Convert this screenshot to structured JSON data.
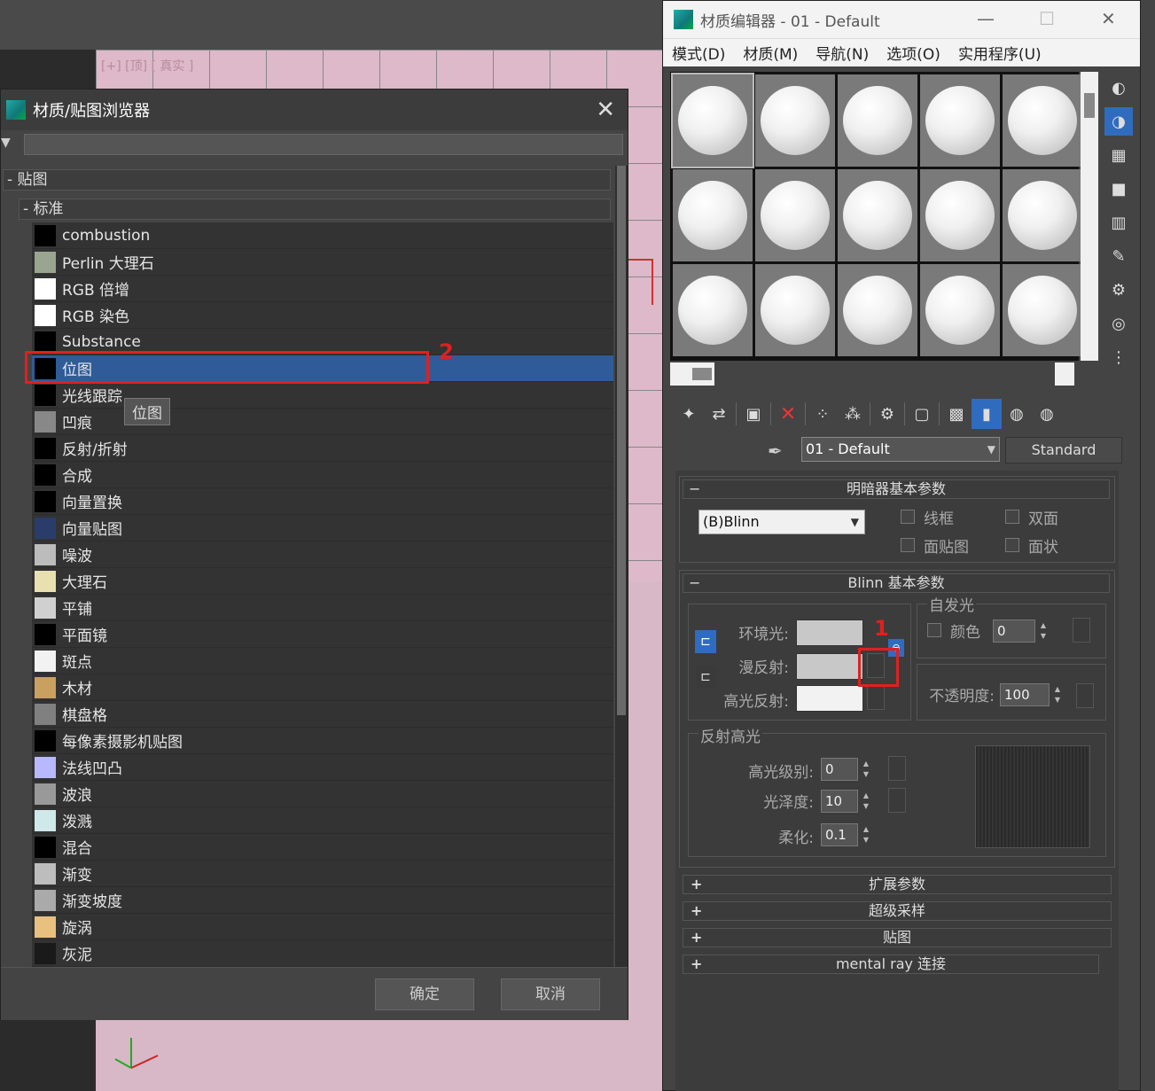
{
  "viewport": {
    "label": "[+] [顶] [ 真实 ]"
  },
  "browser": {
    "title": "材质/贴图浏览器",
    "close": "✕",
    "group_maps": "- 贴图",
    "group_standard": "- 标准",
    "items": [
      {
        "label": "combustion",
        "swatch": "#000000"
      },
      {
        "label": "Perlin 大理石",
        "swatch": "#9aa58f"
      },
      {
        "label": "RGB 倍增",
        "swatch": "#ffffff"
      },
      {
        "label": "RGB 染色",
        "swatch": "#ffffff"
      },
      {
        "label": "Substance",
        "swatch": "#000000"
      },
      {
        "label": "位图",
        "swatch": "#000000"
      },
      {
        "label": "光线跟踪",
        "swatch": "#000000"
      },
      {
        "label": "凹痕",
        "swatch": "#888888"
      },
      {
        "label": "反射/折射",
        "swatch": "#000000"
      },
      {
        "label": "合成",
        "swatch": "#000000"
      },
      {
        "label": "向量置换",
        "swatch": "#000000"
      },
      {
        "label": "向量贴图",
        "swatch": "#2a3d6a"
      },
      {
        "label": "噪波",
        "swatch": "#bcbcbc"
      },
      {
        "label": "大理石",
        "swatch": "#e8e0b0"
      },
      {
        "label": "平铺",
        "swatch": "#d0d0d0"
      },
      {
        "label": "平面镜",
        "swatch": "#000000"
      },
      {
        "label": "斑点",
        "swatch": "#f2f2f2"
      },
      {
        "label": "木材",
        "swatch": "#c8a060"
      },
      {
        "label": "棋盘格",
        "swatch": "#808080"
      },
      {
        "label": "每像素摄影机贴图",
        "swatch": "#000000"
      },
      {
        "label": "法线凹凸",
        "swatch": "#b8b8ff"
      },
      {
        "label": "波浪",
        "swatch": "#999999"
      },
      {
        "label": "泼溅",
        "swatch": "#cfe8ea"
      },
      {
        "label": "混合",
        "swatch": "#000000"
      },
      {
        "label": "渐变",
        "swatch": "#bdbdbd"
      },
      {
        "label": "渐变坡度",
        "swatch": "#aaaaaa"
      },
      {
        "label": "旋涡",
        "swatch": "#e8c080"
      },
      {
        "label": "灰泥",
        "swatch": "#1a1a1a"
      }
    ],
    "selected_index": 5,
    "tooltip": "位图",
    "ok_label": "确定",
    "cancel_label": "取消"
  },
  "annotations": {
    "one": "1",
    "two": "2"
  },
  "editor": {
    "title": "材质编辑器 - 01 - Default",
    "minimize": "—",
    "maximize": "☐",
    "close": "✕",
    "menu": [
      "模式(D)",
      "材质(M)",
      "导航(N)",
      "选项(O)",
      "实用程序(U)"
    ],
    "material_name": "01 - Default",
    "material_type": "Standard",
    "shader_rollout": "明暗器基本参数",
    "shader_value": "(B)Blinn",
    "wire": "线框",
    "two_sided": "双面",
    "face_map": "面贴图",
    "faceted": "面状",
    "blinn_rollout": "Blinn 基本参数",
    "self_illum_group": "自发光",
    "color_label": "颜色",
    "self_illum_value": "0",
    "ambient_label": "环境光:",
    "diffuse_label": "漫反射:",
    "specular_label": "高光反射:",
    "opacity_label": "不透明度:",
    "opacity_value": "100",
    "spec_group": "反射高光",
    "spec_level_label": "高光级别:",
    "spec_level_value": "0",
    "gloss_label": "光泽度:",
    "gloss_value": "10",
    "soften_label": "柔化:",
    "soften_value": "0.1",
    "rollouts_collapsed": [
      "扩展参数",
      "超级采样",
      "贴图",
      "mental ray 连接"
    ],
    "colors": {
      "ambient": "#c8c8c8",
      "diffuse": "#c8c8c8",
      "specular": "#f2f2f2",
      "accent": "#2f6cbf"
    }
  }
}
